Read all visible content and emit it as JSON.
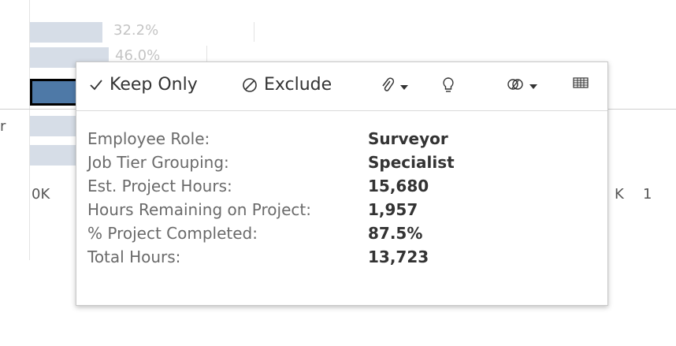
{
  "chart_background": {
    "bar_labels": [
      "32.2%",
      "46.0%"
    ],
    "row_label_fragment": "r",
    "axis_ticks": [
      "0K",
      "K",
      "1"
    ]
  },
  "tooltip": {
    "actions": {
      "keep_only": "Keep Only",
      "exclude": "Exclude"
    },
    "icons": [
      "checkmark-icon",
      "exclude-icon",
      "paperclip-icon",
      "lightbulb-icon",
      "group-icon",
      "view-data-icon"
    ],
    "rows": [
      {
        "label": "Employee Role:",
        "value": "Surveyor"
      },
      {
        "label": "Job Tier Grouping:",
        "value": "Specialist"
      },
      {
        "label": "Est. Project Hours:",
        "value": "15,680"
      },
      {
        "label": "Hours Remaining on Project:",
        "value": "1,957"
      },
      {
        "label": "% Project Completed:",
        "value": "87.5%"
      },
      {
        "label": "Total Hours:",
        "value": "13,723"
      }
    ]
  }
}
